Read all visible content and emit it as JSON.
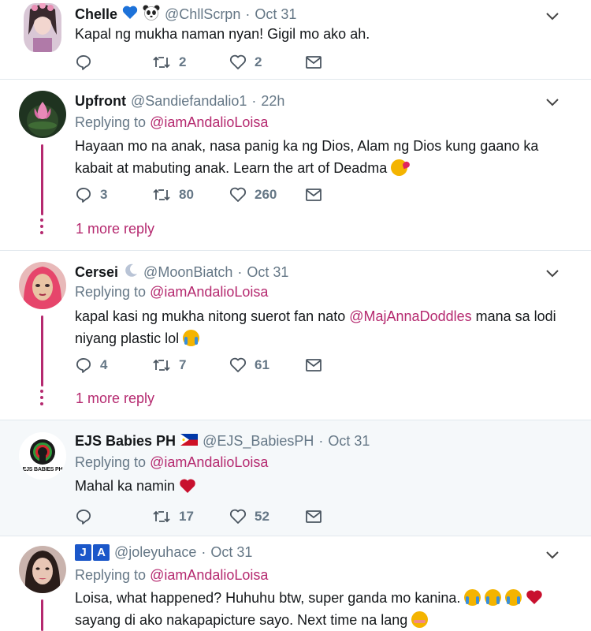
{
  "tweets": [
    {
      "name": "Chelle",
      "handle": "@ChllScrpn",
      "dot": "·",
      "time": "Oct 31",
      "name_icons": [
        "blue-heart-icon",
        "panda-icon"
      ],
      "text": "Kapal ng mukha naman nyan! Gigil mo ako ah.",
      "reply_count": "",
      "retweet_count": "2",
      "like_count": "2"
    },
    {
      "name": "Upfront",
      "handle": "@Sandiefandalio1",
      "dot": "·",
      "time": "22h",
      "replying_label": "Replying to",
      "replying_to": "@iamAndalioLoisa",
      "text": "Hayaan mo na anak, nasa panig ka ng Dios, Alam ng Dios kung gaano ka kabait at mabuting anak. Learn the art of Deadma",
      "text_emoji": "kiss-emoji",
      "reply_count": "3",
      "retweet_count": "80",
      "like_count": "260",
      "more_reply": "1 more reply"
    },
    {
      "name": "Cersei",
      "handle": "@MoonBiatch",
      "dot": "·",
      "time": "Oct 31",
      "name_icons": [
        "crescent-moon-icon"
      ],
      "replying_label": "Replying to",
      "replying_to": "@iamAndalioLoisa",
      "text_before": "kapal kasi ng mukha nitong suerot fan nato",
      "text_mention": "@MajAnnaDoddles",
      "text_after": "mana sa lodi niyang plastic lol",
      "text_emoji": "tears-of-joy-emoji",
      "reply_count": "4",
      "retweet_count": "7",
      "like_count": "61",
      "more_reply": "1 more reply"
    },
    {
      "name": "EJS Babies PH",
      "handle": "@EJS_BabiesPH",
      "dot": "·",
      "time": "Oct 31",
      "name_icons": [
        "philippines-flag-icon"
      ],
      "avatar_text": "EJS BABIES PH",
      "replying_label": "Replying to",
      "replying_to": "@iamAndalioLoisa",
      "text": "Mahal ka namin",
      "text_emoji": "red-heart-emoji",
      "reply_count": "",
      "retweet_count": "17",
      "like_count": "52"
    },
    {
      "name_badges": [
        "J",
        "A"
      ],
      "handle": "@joleyuhace",
      "dot": "·",
      "time": "Oct 31",
      "replying_label": "Replying to",
      "replying_to": "@iamAndalioLoisa",
      "text_line1": "Loisa, what happened? Huhuhu btw, super ganda mo kanina.",
      "text_line2": "sayang di ako nakapapicture sayo. Next time na lang",
      "text_emoji": "blush-emoji"
    }
  ],
  "colors": {
    "accent": "#b5296f",
    "muted": "#657786",
    "text": "#14171a",
    "highlight_bg": "#f5f8fa",
    "blue_heart": "#1d72d9",
    "badge_blue": "#1b57c9"
  }
}
